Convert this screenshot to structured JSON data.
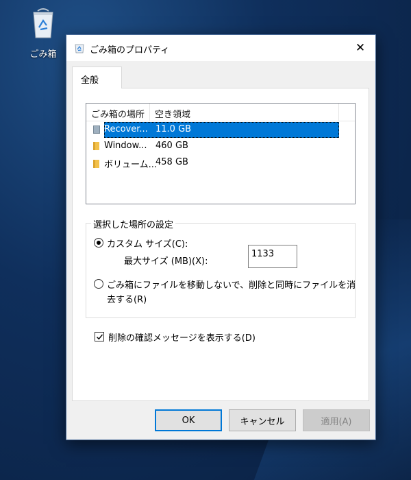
{
  "desktop": {
    "recycle_bin_label": "ごみ箱"
  },
  "window": {
    "title": "ごみ箱のプロパティ",
    "close_glyph": "✕"
  },
  "tabs": [
    {
      "label": "全般",
      "active": true
    }
  ],
  "locations": {
    "columns": [
      "ごみ箱の場所",
      "空き領域"
    ],
    "rows": [
      {
        "name": "Recover...",
        "free_space": "11.0 GB",
        "selected": true,
        "icon": "drive-folder-icon"
      },
      {
        "name": "Window...",
        "free_space": "460 GB",
        "selected": false,
        "icon": "folder-icon"
      },
      {
        "name": "ボリューム...",
        "free_space": "458 GB",
        "selected": false,
        "icon": "folder-icon"
      }
    ]
  },
  "settings": {
    "group_title": "選択した場所の設定",
    "custom_size_label": "カスタム サイズ(C):",
    "custom_size_checked": true,
    "max_size_label": "最大サイズ (MB)(X):",
    "max_size_value": "1133",
    "no_move_label_line1": "ごみ箱にファイルを移動しないで、削除と同時にファイルを消",
    "no_move_label_line2": "去する(R)",
    "no_move_checked": false
  },
  "confirm_delete": {
    "label": "削除の確認メッセージを表示する(D)",
    "checked": true
  },
  "buttons": {
    "ok": "OK",
    "cancel": "キャンセル",
    "apply": "適用(A)"
  },
  "colors": {
    "selection": "#0078d7",
    "folder": "#f2c04a"
  }
}
